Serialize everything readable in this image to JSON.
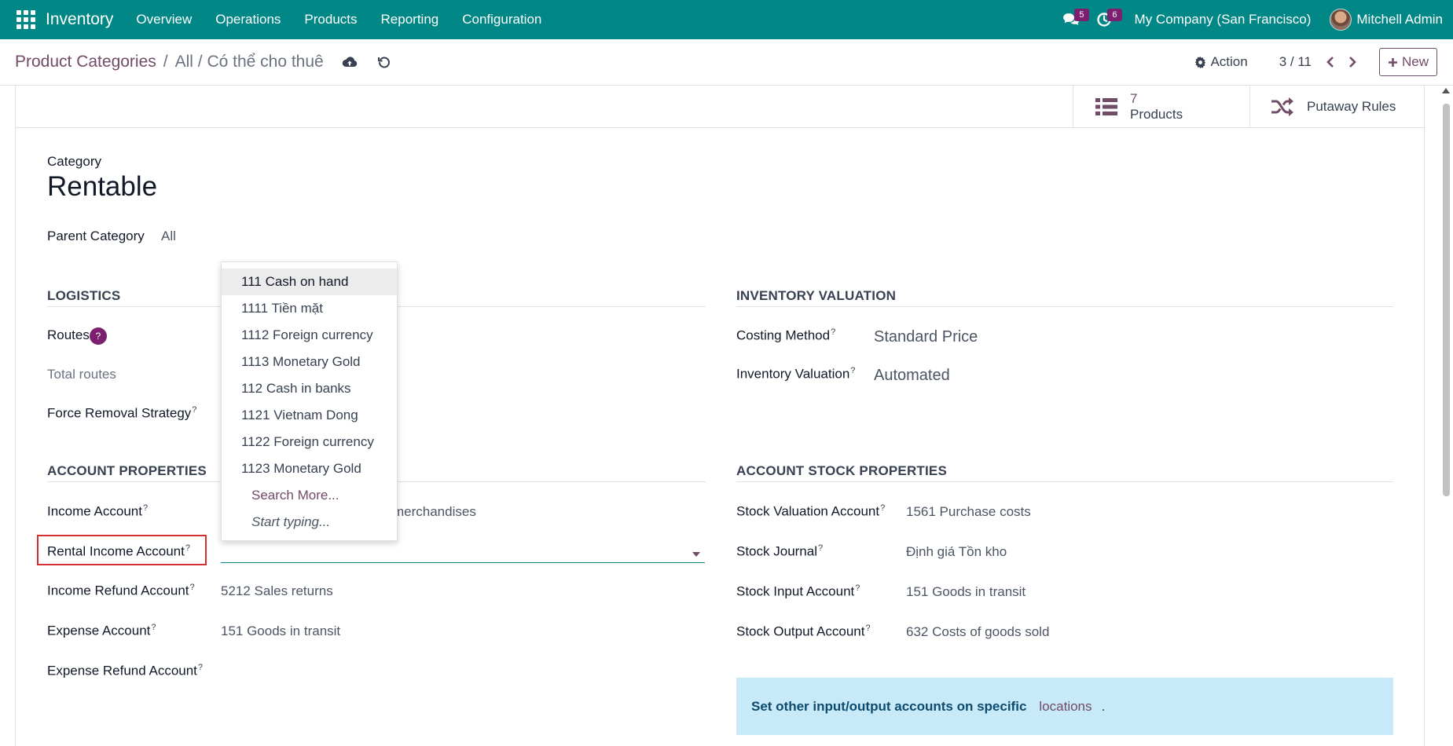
{
  "navbar": {
    "brand": "Inventory",
    "menu": [
      "Overview",
      "Operations",
      "Products",
      "Reporting",
      "Configuration"
    ],
    "messages_count": "5",
    "activities_count": "6",
    "company": "My Company (San Francisco)",
    "user": "Mitchell Admin"
  },
  "control_panel": {
    "breadcrumb_root": "Product Categories",
    "breadcrumb_sep": "/",
    "breadcrumb_current": "All / Có thể cho thuê",
    "action_label": "Action",
    "pager": "3 / 11",
    "new_label": "New"
  },
  "smart_buttons": {
    "products_count": "7",
    "products_label": "Products",
    "putaway_label": "Putaway Rules"
  },
  "form": {
    "category_label": "Category",
    "category_name": "Rentable",
    "parent_label": "Parent Category",
    "parent_value": "All",
    "logistics_title": "LOGISTICS",
    "routes_label": "Routes",
    "total_routes_label": "Total routes",
    "force_removal_label": "Force Removal Strategy",
    "inventory_valuation_title": "INVENTORY VALUATION",
    "costing_method_label": "Costing Method",
    "costing_method_value": "Standard Price",
    "inventory_valuation_label": "Inventory Valuation",
    "inventory_valuation_value": "Automated",
    "account_properties_title": "ACCOUNT PROPERTIES",
    "income_account_label": "Income Account",
    "income_account_value_partial": "merchandises",
    "rental_income_label": "Rental Income Account",
    "income_refund_label": "Income Refund Account",
    "income_refund_value": "5212 Sales returns",
    "expense_account_label": "Expense Account",
    "expense_account_value": "151 Goods in transit",
    "expense_refund_label": "Expense Refund Account",
    "stock_properties_title": "ACCOUNT STOCK PROPERTIES",
    "stock_valuation_label": "Stock Valuation Account",
    "stock_valuation_value": "1561 Purchase costs",
    "stock_journal_label": "Stock Journal",
    "stock_journal_value": "Định giá Tồn kho",
    "stock_input_label": "Stock Input Account",
    "stock_input_value": "151 Goods in transit",
    "stock_output_label": "Stock Output Account",
    "stock_output_value": "632 Costs of goods sold",
    "help_mark": "?"
  },
  "dropdown": {
    "items": [
      "111 Cash on hand",
      "1111 Tiền mặt",
      "1112 Foreign currency",
      "1113 Monetary Gold",
      "112 Cash in banks",
      "1121 Vietnam Dong",
      "1122 Foreign currency",
      "1123 Monetary Gold"
    ],
    "search_more": "Search More...",
    "start_typing": "Start typing..."
  },
  "alert": {
    "text": "Set other input/output accounts on specific",
    "link": "locations",
    "dot": "."
  },
  "colors": {
    "navbar": "#018786",
    "brand_purple": "#714B67",
    "badge": "#7c1f6f",
    "highlight_red": "#d32f2f",
    "alert_bg": "#c8e9f7"
  }
}
